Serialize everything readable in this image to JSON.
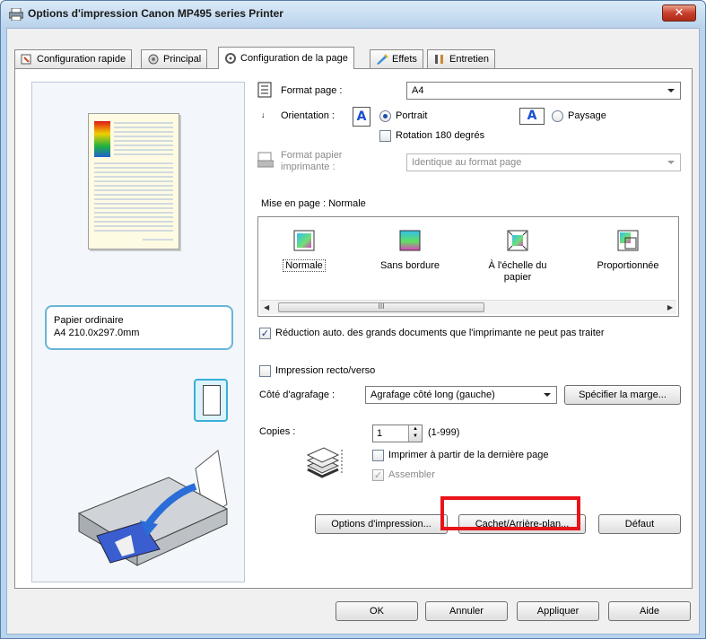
{
  "window": {
    "title": "Options d'impression Canon MP495 series Printer",
    "close_label": "✕"
  },
  "tabs": [
    {
      "label": "Configuration rapide",
      "icon": "quick-setup-icon"
    },
    {
      "label": "Principal",
      "icon": "main-icon"
    },
    {
      "label": "Configuration de la page",
      "icon": "page-setup-icon"
    },
    {
      "label": "Effets",
      "icon": "effects-icon"
    },
    {
      "label": "Entretien",
      "icon": "maintenance-icon"
    }
  ],
  "preview": {
    "paper_type": "Papier ordinaire",
    "paper_size": "A4 210.0x297.0mm"
  },
  "page_setup": {
    "page_size_label": "Format page :",
    "page_size_value": "A4",
    "orientation_label": "Orientation :",
    "portrait_label": "Portrait",
    "landscape_label": "Paysage",
    "orientation_glyph": "A",
    "rotate_label": "Rotation 180 degrés",
    "printer_paper_label_1": "Format papier",
    "printer_paper_label_2": "imprimante :",
    "printer_paper_value": "Identique au format page",
    "layout_label": "Mise en page : Normale",
    "layouts": [
      {
        "label": "Normale",
        "label2": ""
      },
      {
        "label": "Sans bordure",
        "label2": ""
      },
      {
        "label": "À l'échelle du",
        "label2": "papier"
      },
      {
        "label": "Proportionnée",
        "label2": ""
      }
    ],
    "scroll_thumb": "III",
    "auto_reduce_label": "Réduction auto. des grands documents que l'imprimante ne peut pas traiter",
    "duplex_label": "Impression recto/verso",
    "stapling_label": "Côté d'agrafage :",
    "stapling_value": "Agrafage côté long (gauche)",
    "margin_button": "Spécifier la marge...",
    "copies_label": "Copies :",
    "copies_value": "1",
    "copies_range": "(1-999)",
    "reverse_label": "Imprimer à partir de la dernière page",
    "collate_label": "Assembler",
    "print_options_button": "Options d'impression...",
    "stamp_button": "Cachet/Arrière-plan...",
    "default_button": "Défaut"
  },
  "footer": {
    "ok": "OK",
    "cancel": "Annuler",
    "apply": "Appliquer",
    "help": "Aide"
  },
  "colors": {
    "highlight": "#e8141a",
    "accent": "#3aaed8"
  }
}
